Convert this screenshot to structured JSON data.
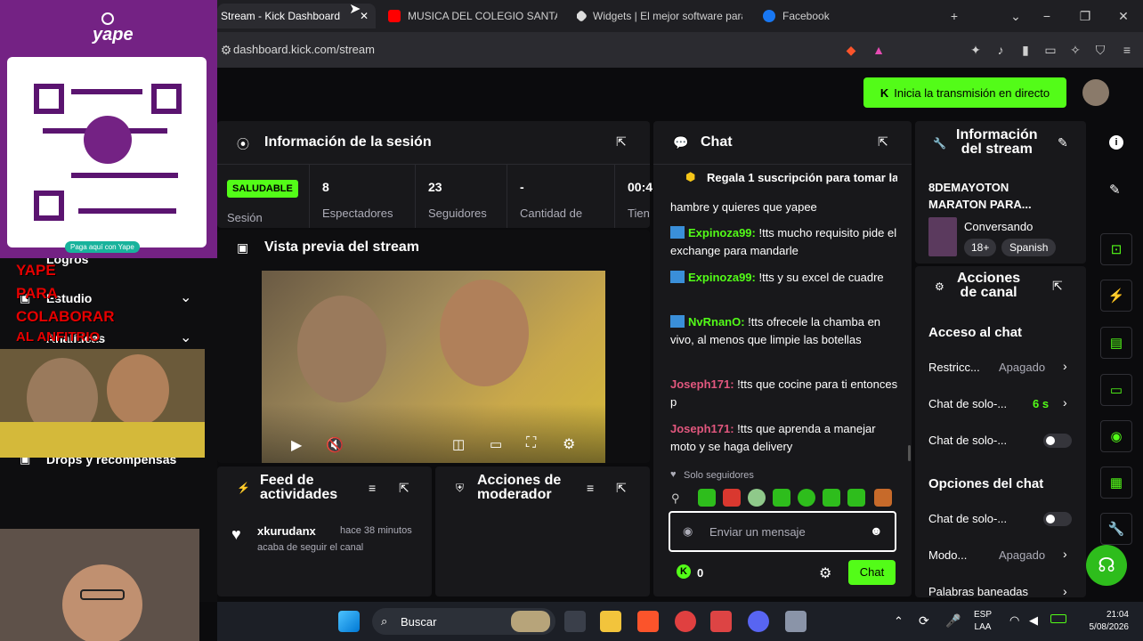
{
  "browser": {
    "tabs": [
      {
        "label": "Stream - Kick Dashboard",
        "icon": "kick-favicon"
      },
      {
        "label": "MUSICA DEL COLEGIO SANTA M",
        "icon": "youtube-favicon"
      },
      {
        "label": "Widgets | El mejor software para",
        "icon": "streamelements-favicon"
      },
      {
        "label": "Facebook",
        "icon": "facebook-favicon"
      }
    ],
    "url": "dashboard.kick.com/stream"
  },
  "header": {
    "go_live_label": "Inicia la transmisión en directo"
  },
  "session": {
    "title": "Información de la sesión",
    "status_badge": "SALUDABLE",
    "status_label": "Sesión",
    "stats": [
      {
        "value": "8",
        "label": "Espectadores"
      },
      {
        "value": "23",
        "label": "Seguidores"
      },
      {
        "value": "-",
        "label": "Cantidad de"
      },
      {
        "value": "00:4",
        "label": "Tien"
      }
    ]
  },
  "preview": {
    "title": "Vista previa del stream"
  },
  "feed": {
    "title_line1": "Feed de",
    "title_line2": "actividades",
    "items": [
      {
        "user": "xkurudanx",
        "time": "hace 38 minutos",
        "text": "acaba de seguir el canal"
      }
    ]
  },
  "moderator": {
    "title_line1": "Acciones de",
    "title_line2": "moderador"
  },
  "chat": {
    "title": "Chat",
    "pinned": "Regala 1 suscripción para tomar la",
    "partial_top": "hambre y quieres que yapee",
    "messages": [
      {
        "user": "Expinoza99:",
        "text": " !tts mucho requisito pide el exchange para mandarle",
        "color": "#53fc18"
      },
      {
        "user": "Expinoza99:",
        "text": " !tts y su excel de cuadre",
        "color": "#53fc18"
      },
      {
        "user": "NvRnanO:",
        "text": " !tts ofrecele la chamba en vivo, al menos que limpie las botellas",
        "color": "#53fc18"
      },
      {
        "user": "Joseph171:",
        "text": " !tts que cocine para ti entonces p",
        "color": "#e2577e"
      },
      {
        "user": "Joseph171:",
        "text": " !tts que aprenda a manejar moto y se haga delivery",
        "color": "#e2577e"
      }
    ],
    "followers_only": "Solo seguidores",
    "input_placeholder": "Enviar un mensaje",
    "points": "0",
    "send_label": "Chat"
  },
  "stream_info": {
    "title_line1": "Información",
    "title_line2": "del stream",
    "stream_title_line1": "8DEMAYOTON",
    "stream_title_line2": "MARATON PARA...",
    "category": "Conversando",
    "tags": [
      "18+",
      "Spanish"
    ]
  },
  "channel_actions": {
    "title_line1": "Acciones",
    "title_line2": "de canal",
    "chat_access_title": "Acceso al chat",
    "rows_access": [
      {
        "label": "Restricc...",
        "value": "Apagado"
      },
      {
        "label": "Chat de solo-...",
        "value": "6 s"
      },
      {
        "label": "Chat de solo-...",
        "value": ""
      }
    ],
    "chat_options_title": "Opciones del chat",
    "rows_options": [
      {
        "label": "Chat de solo-...",
        "value": ""
      },
      {
        "label": "Modo...",
        "value": "Apagado"
      },
      {
        "label": "Palabras baneadas",
        "value": ""
      }
    ]
  },
  "left_nav": {
    "items": [
      "Logros",
      "Estudio",
      "Analíticas",
      "Drops y recompensas"
    ]
  },
  "overlay": {
    "yape_logo": "yape",
    "yape_footer": "Paga aquí con Yape",
    "promo_lines": [
      "YAPE",
      "PARA",
      "COLABORAR",
      "AL ANFITRIO"
    ]
  },
  "taskbar": {
    "search_label": "Buscar",
    "lang_line1": "ESP",
    "lang_line2": "LAA",
    "time": "21:04",
    "date": "5/08/2026"
  },
  "colors": {
    "kick_green": "#53fc18",
    "yape_purple": "#742284",
    "panel": "#18181b"
  }
}
